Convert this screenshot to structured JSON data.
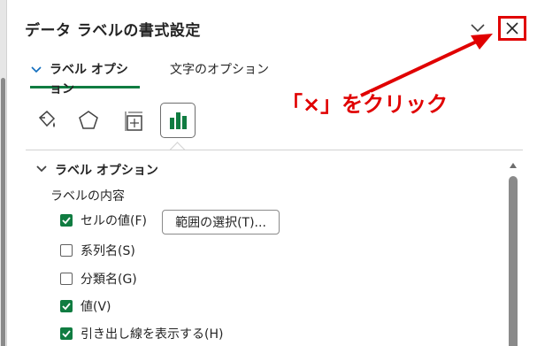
{
  "pane": {
    "title": "データ ラベルの書式設定"
  },
  "tabs": {
    "label_options": "ラベル オプション",
    "text_options": "文字のオプション"
  },
  "icons": [
    "fill-line-icon",
    "effects-pentagon-icon",
    "size-properties-icon",
    "label-options-chart-icon"
  ],
  "section": {
    "header": "ラベル オプション",
    "content_label": "ラベルの内容"
  },
  "options": [
    {
      "label": "セルの値(F)",
      "checked": true
    },
    {
      "label": "系列名(S)",
      "checked": false
    },
    {
      "label": "分類名(G)",
      "checked": false
    },
    {
      "label": "値(V)",
      "checked": true
    },
    {
      "label": "引き出し線を表示する(H)",
      "checked": true
    }
  ],
  "range_button": "範囲の選択(T)...",
  "annotation": {
    "text": "「×」をクリック",
    "color": "#e00000"
  },
  "colors": {
    "accent_green": "#107c41",
    "highlight_red": "#e00000"
  }
}
